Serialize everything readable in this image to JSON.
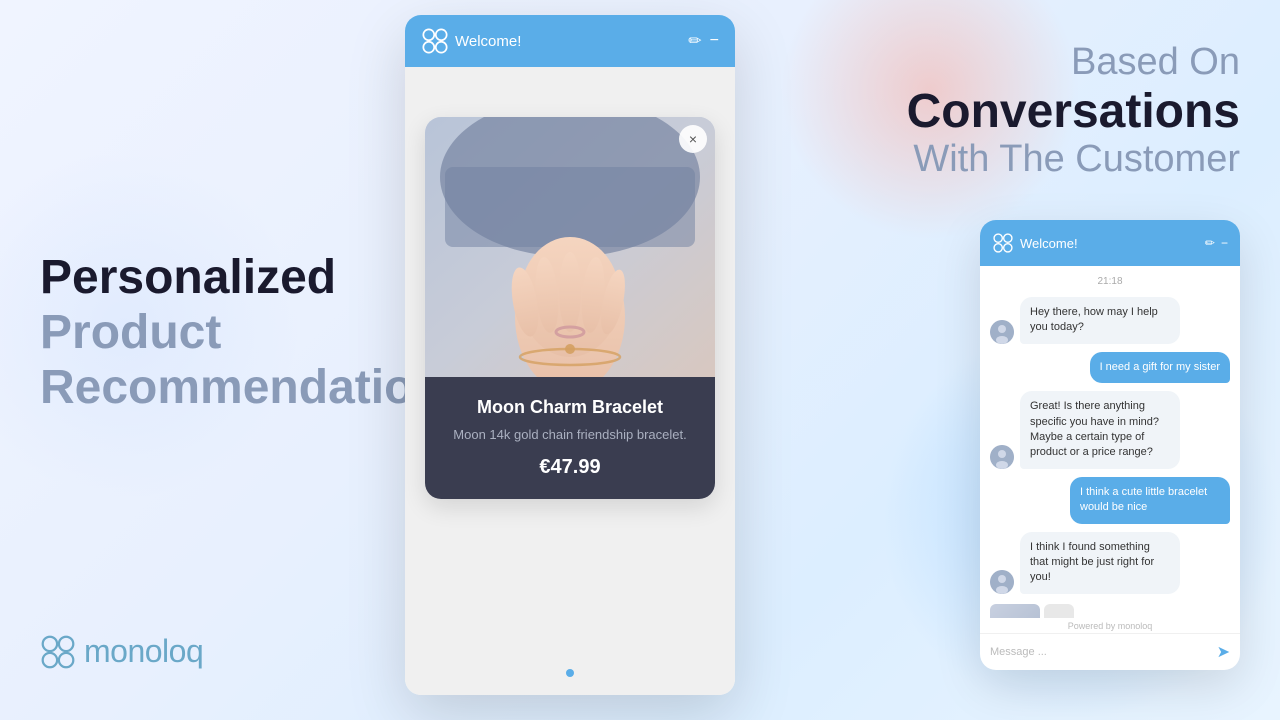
{
  "background": {
    "gradient": "linear-gradient(135deg, #f0f4ff, #dceeff)"
  },
  "left_section": {
    "line1": "Personalized",
    "line2": "Product",
    "line3": "Recommendations"
  },
  "right_section": {
    "line1": "Based On",
    "line2": "Conversations",
    "line3": "With The Customer"
  },
  "logo": {
    "text": "monoloq"
  },
  "large_widget": {
    "header": {
      "title": "Welcome!",
      "logo_alt": "monoloq logo"
    },
    "product": {
      "name": "Moon Charm Bracelet",
      "description": "Moon 14k gold chain friendship bracelet.",
      "price": "€47.99",
      "close_label": "×"
    }
  },
  "chat_widget": {
    "header": {
      "title": "Welcome!"
    },
    "timestamp": "21:18",
    "messages": [
      {
        "type": "bot",
        "text": "Hey there, how may I help you today?"
      },
      {
        "type": "user",
        "text": "I need a gift for my sister"
      },
      {
        "type": "bot",
        "text": "Great! Is there anything specific you have in mind? Maybe a certain type of product or a price range?"
      },
      {
        "type": "user",
        "text": "I think a cute little bracelet would be nice"
      },
      {
        "type": "bot",
        "text": "I think I found something that might be just right for you!"
      }
    ],
    "input_placeholder": "Message ...",
    "powered_by": "Powered by  monoloq"
  }
}
